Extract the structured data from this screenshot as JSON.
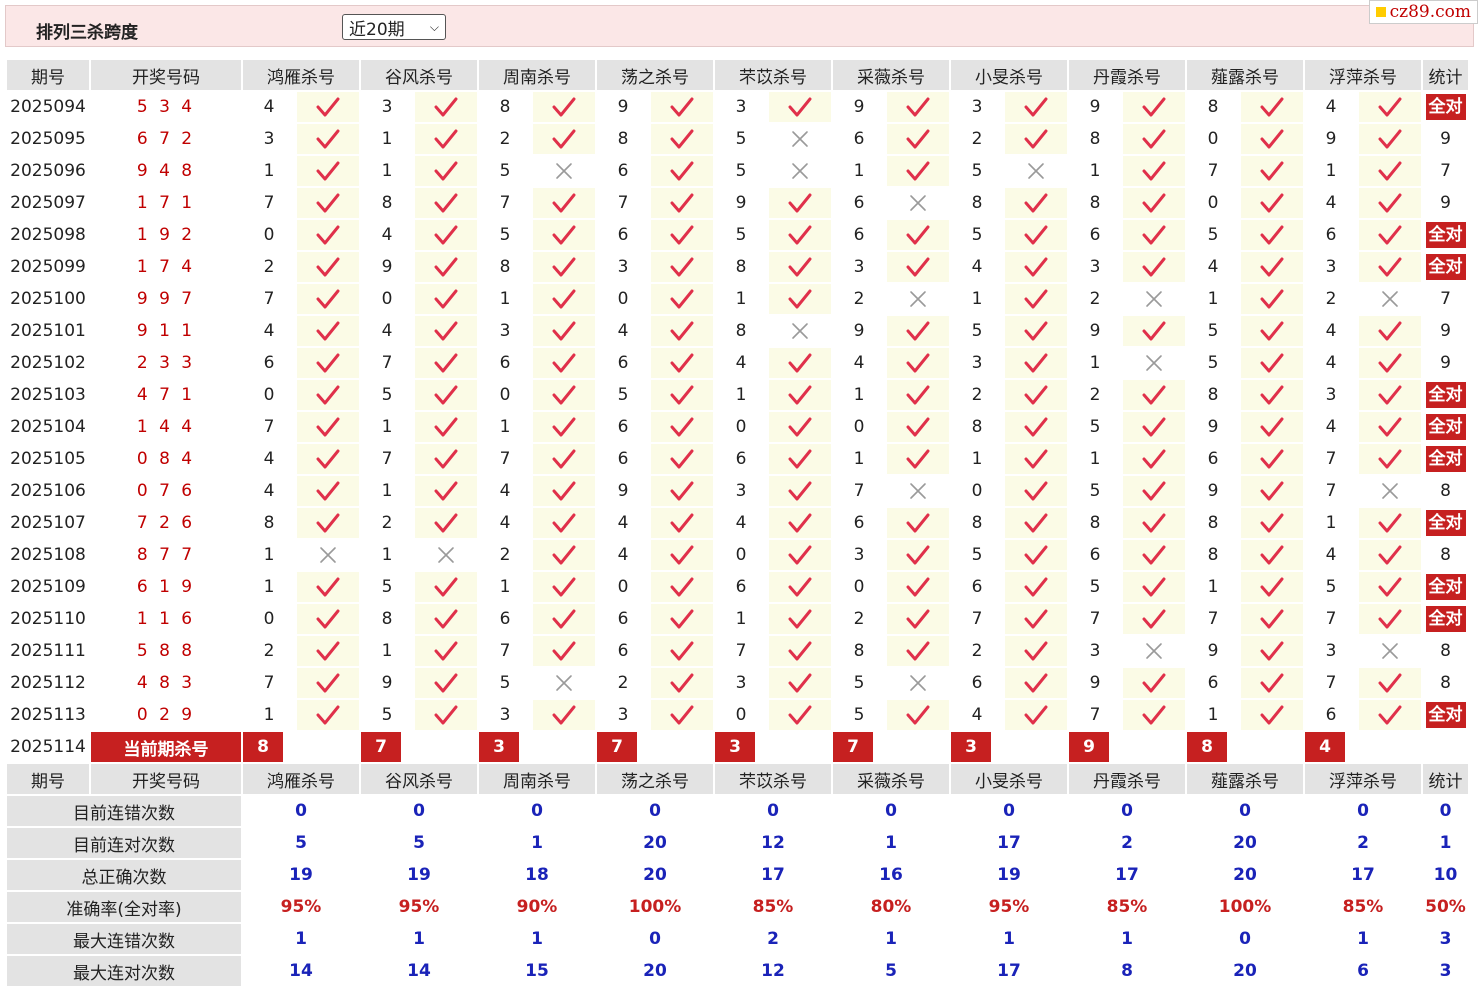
{
  "header": {
    "title": "排列三杀跨度",
    "period_select": "近20期",
    "logo": "cz89.com"
  },
  "columns": {
    "issue": "期号",
    "draw": "开奖号码",
    "experts": [
      "鸿雁杀号",
      "谷风杀号",
      "周南杀号",
      "荡之杀号",
      "芣苡杀号",
      "采薇杀号",
      "小旻杀号",
      "丹霞杀号",
      "薤露杀号",
      "浮萍杀号"
    ],
    "stat": "统计"
  },
  "rows": [
    {
      "issue": "2025094",
      "draw": "5 3 4",
      "kills": [
        4,
        3,
        8,
        9,
        3,
        9,
        3,
        9,
        8,
        4
      ],
      "ok": [
        1,
        1,
        1,
        1,
        1,
        1,
        1,
        1,
        1,
        1
      ],
      "stat": "全对"
    },
    {
      "issue": "2025095",
      "draw": "6 7 2",
      "kills": [
        3,
        1,
        2,
        8,
        5,
        6,
        2,
        8,
        0,
        9
      ],
      "ok": [
        1,
        1,
        1,
        1,
        0,
        1,
        1,
        1,
        1,
        1
      ],
      "stat": "9"
    },
    {
      "issue": "2025096",
      "draw": "9 4 8",
      "kills": [
        1,
        1,
        5,
        6,
        5,
        1,
        5,
        1,
        7,
        1
      ],
      "ok": [
        1,
        1,
        0,
        1,
        0,
        1,
        0,
        1,
        1,
        1
      ],
      "stat": "7"
    },
    {
      "issue": "2025097",
      "draw": "1 7 1",
      "kills": [
        7,
        8,
        7,
        7,
        9,
        6,
        8,
        8,
        0,
        4
      ],
      "ok": [
        1,
        1,
        1,
        1,
        1,
        0,
        1,
        1,
        1,
        1
      ],
      "stat": "9"
    },
    {
      "issue": "2025098",
      "draw": "1 9 2",
      "kills": [
        0,
        4,
        5,
        6,
        5,
        6,
        5,
        6,
        5,
        6
      ],
      "ok": [
        1,
        1,
        1,
        1,
        1,
        1,
        1,
        1,
        1,
        1
      ],
      "stat": "全对"
    },
    {
      "issue": "2025099",
      "draw": "1 7 4",
      "kills": [
        2,
        9,
        8,
        3,
        8,
        3,
        4,
        3,
        4,
        3
      ],
      "ok": [
        1,
        1,
        1,
        1,
        1,
        1,
        1,
        1,
        1,
        1
      ],
      "stat": "全对"
    },
    {
      "issue": "2025100",
      "draw": "9 9 7",
      "kills": [
        7,
        0,
        1,
        0,
        1,
        2,
        1,
        2,
        1,
        2
      ],
      "ok": [
        1,
        1,
        1,
        1,
        1,
        0,
        1,
        0,
        1,
        0
      ],
      "stat": "7"
    },
    {
      "issue": "2025101",
      "draw": "9 1 1",
      "kills": [
        4,
        4,
        3,
        4,
        8,
        9,
        5,
        9,
        5,
        4
      ],
      "ok": [
        1,
        1,
        1,
        1,
        0,
        1,
        1,
        1,
        1,
        1
      ],
      "stat": "9"
    },
    {
      "issue": "2025102",
      "draw": "2 3 3",
      "kills": [
        6,
        7,
        6,
        6,
        4,
        4,
        3,
        1,
        5,
        4
      ],
      "ok": [
        1,
        1,
        1,
        1,
        1,
        1,
        1,
        0,
        1,
        1
      ],
      "stat": "9"
    },
    {
      "issue": "2025103",
      "draw": "4 7 1",
      "kills": [
        0,
        5,
        0,
        5,
        1,
        1,
        2,
        2,
        8,
        3
      ],
      "ok": [
        1,
        1,
        1,
        1,
        1,
        1,
        1,
        1,
        1,
        1
      ],
      "stat": "全对"
    },
    {
      "issue": "2025104",
      "draw": "1 4 4",
      "kills": [
        7,
        1,
        1,
        6,
        0,
        0,
        8,
        5,
        9,
        4
      ],
      "ok": [
        1,
        1,
        1,
        1,
        1,
        1,
        1,
        1,
        1,
        1
      ],
      "stat": "全对"
    },
    {
      "issue": "2025105",
      "draw": "0 8 4",
      "kills": [
        4,
        7,
        7,
        6,
        6,
        1,
        1,
        1,
        6,
        7
      ],
      "ok": [
        1,
        1,
        1,
        1,
        1,
        1,
        1,
        1,
        1,
        1
      ],
      "stat": "全对"
    },
    {
      "issue": "2025106",
      "draw": "0 7 6",
      "kills": [
        4,
        1,
        4,
        9,
        3,
        7,
        0,
        5,
        9,
        7
      ],
      "ok": [
        1,
        1,
        1,
        1,
        1,
        0,
        1,
        1,
        1,
        0
      ],
      "stat": "8"
    },
    {
      "issue": "2025107",
      "draw": "7 2 6",
      "kills": [
        8,
        2,
        4,
        4,
        4,
        6,
        8,
        8,
        8,
        1
      ],
      "ok": [
        1,
        1,
        1,
        1,
        1,
        1,
        1,
        1,
        1,
        1
      ],
      "stat": "全对"
    },
    {
      "issue": "2025108",
      "draw": "8 7 7",
      "kills": [
        1,
        1,
        2,
        4,
        0,
        3,
        5,
        6,
        8,
        4
      ],
      "ok": [
        0,
        0,
        1,
        1,
        1,
        1,
        1,
        1,
        1,
        1
      ],
      "stat": "8"
    },
    {
      "issue": "2025109",
      "draw": "6 1 9",
      "kills": [
        1,
        5,
        1,
        0,
        6,
        0,
        6,
        5,
        1,
        5
      ],
      "ok": [
        1,
        1,
        1,
        1,
        1,
        1,
        1,
        1,
        1,
        1
      ],
      "stat": "全对"
    },
    {
      "issue": "2025110",
      "draw": "1 1 6",
      "kills": [
        0,
        8,
        6,
        6,
        1,
        2,
        7,
        7,
        7,
        7
      ],
      "ok": [
        1,
        1,
        1,
        1,
        1,
        1,
        1,
        1,
        1,
        1
      ],
      "stat": "全对"
    },
    {
      "issue": "2025111",
      "draw": "5 8 8",
      "kills": [
        2,
        1,
        7,
        6,
        7,
        8,
        2,
        3,
        9,
        3
      ],
      "ok": [
        1,
        1,
        1,
        1,
        1,
        1,
        1,
        0,
        1,
        0
      ],
      "stat": "8"
    },
    {
      "issue": "2025112",
      "draw": "4 8 3",
      "kills": [
        7,
        9,
        5,
        2,
        3,
        5,
        6,
        9,
        6,
        7
      ],
      "ok": [
        1,
        1,
        0,
        1,
        1,
        0,
        1,
        1,
        1,
        1
      ],
      "stat": "8"
    },
    {
      "issue": "2025113",
      "draw": "0 2 9",
      "kills": [
        1,
        5,
        3,
        3,
        0,
        5,
        4,
        7,
        1,
        6
      ],
      "ok": [
        1,
        1,
        1,
        1,
        1,
        1,
        1,
        1,
        1,
        1
      ],
      "stat": "全对"
    }
  ],
  "current": {
    "issue": "2025114",
    "label": "当前期杀号",
    "kills": [
      8,
      7,
      3,
      7,
      3,
      7,
      3,
      9,
      8,
      4
    ]
  },
  "stats": [
    {
      "label": "目前连错次数",
      "values": [
        "0",
        "0",
        "0",
        "0",
        "0",
        "0",
        "0",
        "0",
        "0",
        "0"
      ],
      "total": "0",
      "color": "blue"
    },
    {
      "label": "目前连对次数",
      "values": [
        "5",
        "5",
        "1",
        "20",
        "12",
        "1",
        "17",
        "2",
        "20",
        "2"
      ],
      "total": "1",
      "color": "blue"
    },
    {
      "label": "总正确次数",
      "values": [
        "19",
        "19",
        "18",
        "20",
        "17",
        "16",
        "19",
        "17",
        "20",
        "17"
      ],
      "total": "10",
      "color": "blue"
    },
    {
      "label": "准确率(全对率)",
      "values": [
        "95%",
        "95%",
        "90%",
        "100%",
        "85%",
        "80%",
        "95%",
        "85%",
        "100%",
        "85%"
      ],
      "total": "50%",
      "color": "red"
    },
    {
      "label": "最大连错次数",
      "values": [
        "1",
        "1",
        "1",
        "0",
        "2",
        "1",
        "1",
        "1",
        "0",
        "1"
      ],
      "total": "3",
      "color": "blue"
    },
    {
      "label": "最大连对次数",
      "values": [
        "14",
        "14",
        "15",
        "20",
        "12",
        "5",
        "17",
        "8",
        "20",
        "6"
      ],
      "total": "3",
      "color": "blue"
    }
  ],
  "colors": {
    "accent_red": "#c62020",
    "check_red": "#e0304a",
    "cross_gray": "#9a9a9a",
    "stat_blue": "#1a23b8",
    "header_gray": "#e3e3e3",
    "ok_bg": "#fbfbe6"
  }
}
